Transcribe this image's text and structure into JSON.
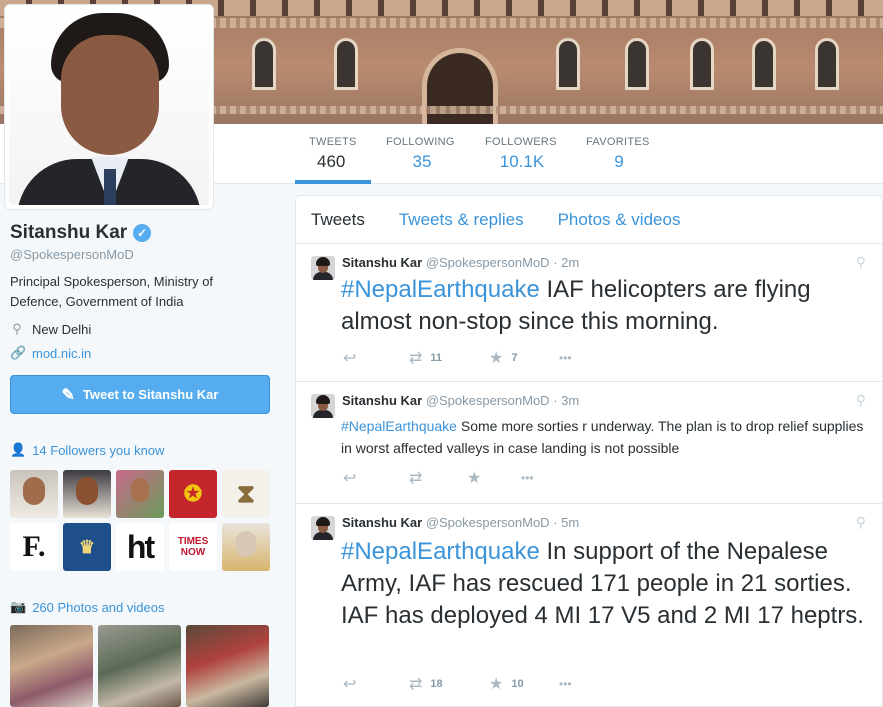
{
  "profile": {
    "name": "Sitanshu Kar",
    "verified_icon": "✓",
    "handle": "@SpokespersonMoD",
    "bio": "Principal Spokesperson, Ministry of Defence, Government of India",
    "location": "New Delhi",
    "website": "mod.nic.in",
    "tweet_to_label": "Tweet to Sitanshu Kar",
    "followers_you_know": "14 Followers you know",
    "photos_videos": "260 Photos and videos"
  },
  "stats": [
    {
      "label": "TWEETS",
      "value": "460"
    },
    {
      "label": "FOLLOWING",
      "value": "35"
    },
    {
      "label": "FOLLOWERS",
      "value": "10.1K"
    },
    {
      "label": "FAVORITES",
      "value": "9"
    }
  ],
  "follower_tiles": [
    "F.",
    "ht",
    "TIMES NOW"
  ],
  "timeline": {
    "tabs": [
      "Tweets",
      "Tweets & replies",
      "Photos & videos"
    ],
    "tweets": [
      {
        "name": "Sitanshu Kar",
        "handle": "@SpokespersonMoD",
        "time": "· 2m",
        "hashtag": "#NepalEarthquake",
        "text": " IAF helicopters are flying almost non-stop since this morning.",
        "retweets": "11",
        "favorites": "7"
      },
      {
        "name": "Sitanshu Kar",
        "handle": "@SpokespersonMoD",
        "time": "· 3m",
        "hashtag": "#NepalEarthquake",
        "text": " Some more sorties r underway. The plan is to drop relief supplies in worst affected valleys in case landing is not possible",
        "retweets": "",
        "favorites": ""
      },
      {
        "name": "Sitanshu Kar",
        "handle": "@SpokespersonMoD",
        "time": "· 5m",
        "hashtag": "#NepalEarthquake",
        "text": " In support of the Nepalese Army, IAF has rescued 171 people in 21 sorties. IAF has deployed 4 MI 17 V5 and 2 MI 17 heptrs.",
        "retweets": "18",
        "favorites": "10"
      }
    ]
  },
  "icons": {
    "reply": "↩",
    "retweet": "⇄",
    "favorite": "★",
    "more": "•••",
    "location": "⚲",
    "link": "🔗",
    "person": "👤",
    "camera": "📷"
  },
  "colors": {
    "accent": "#55acee",
    "link": "#3b94d9"
  }
}
